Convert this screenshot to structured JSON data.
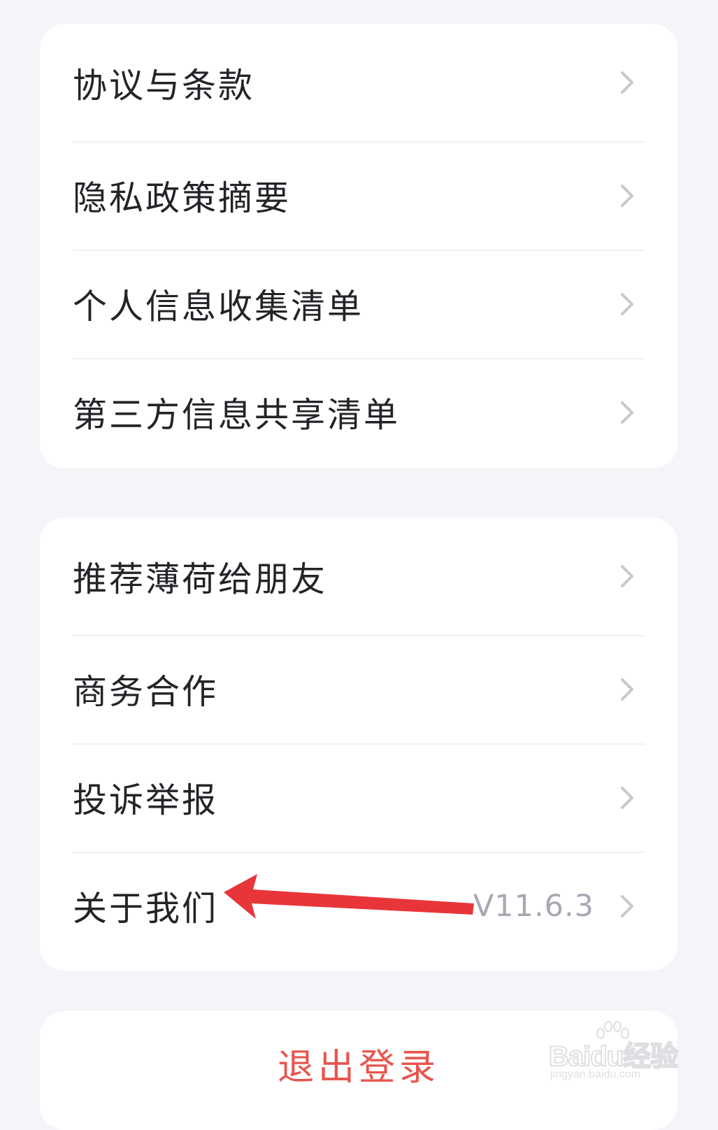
{
  "colors": {
    "page_background": "#f4f5f9",
    "card_background": "#ffffff",
    "primary_text": "#222428",
    "secondary_text": "#a6a9b2",
    "chevron": "#c6c8ce",
    "danger": "#e8554e",
    "annotation_arrow": "#e8353a"
  },
  "legal_section": {
    "items": [
      {
        "label": "协议与条款",
        "icon": "chevron-right-icon"
      },
      {
        "label": "隐私政策摘要",
        "icon": "chevron-right-icon"
      },
      {
        "label": "个人信息收集清单",
        "icon": "chevron-right-icon"
      },
      {
        "label": "第三方信息共享清单",
        "icon": "chevron-right-icon"
      }
    ]
  },
  "more_section": {
    "items": [
      {
        "label": "推荐薄荷给朋友",
        "icon": "chevron-right-icon"
      },
      {
        "label": "商务合作",
        "icon": "chevron-right-icon"
      },
      {
        "label": "投诉举报",
        "icon": "chevron-right-icon"
      },
      {
        "label": "关于我们",
        "value": "V11.6.3",
        "icon": "chevron-right-icon"
      }
    ]
  },
  "logout": {
    "label": "退出登录"
  },
  "watermark": {
    "brand": "Baidu经验",
    "url": "jingyan.baidu.com"
  }
}
